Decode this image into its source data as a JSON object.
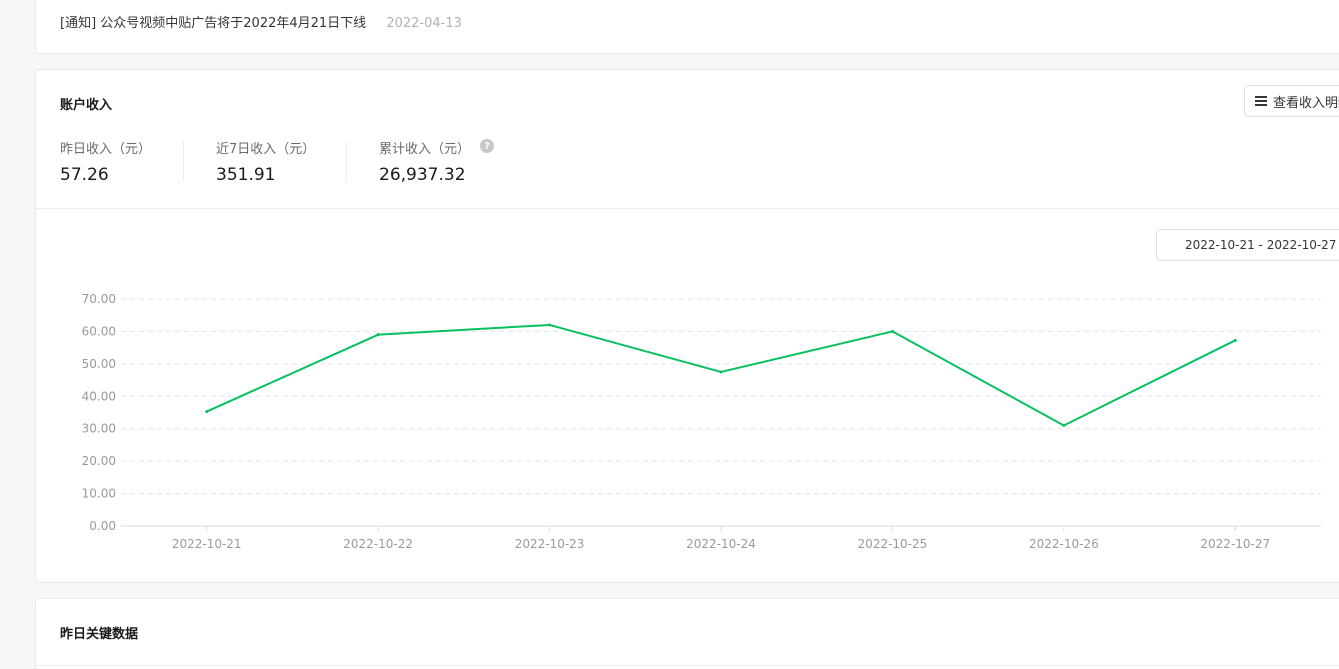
{
  "notice": {
    "text": "[通知] 公众号视频中贴广告将于2022年4月21日下线",
    "date": "2022-04-13"
  },
  "income": {
    "title": "账户收入",
    "detail_button": "查看收入明细",
    "stats": [
      {
        "label": "昨日收入（元）",
        "value": "57.26"
      },
      {
        "label": "近7日收入（元）",
        "value": "351.91"
      },
      {
        "label": "累计收入（元）",
        "value": "26,937.32"
      }
    ],
    "help_icon": "?",
    "date_range": "2022-10-21 - 2022-10-27"
  },
  "keydata": {
    "title": "昨日关键数据"
  },
  "colors": {
    "accent": "#07c160",
    "grid": "#e5e5e5",
    "axis_text": "#9a9a9a"
  },
  "chart_data": {
    "type": "line",
    "x": [
      "2022-10-21",
      "2022-10-22",
      "2022-10-23",
      "2022-10-24",
      "2022-10-25",
      "2022-10-26",
      "2022-10-27"
    ],
    "series": [
      {
        "values": [
          35.3,
          59.0,
          62.0,
          47.5,
          60.0,
          31.0,
          57.26
        ]
      }
    ],
    "yticks": [
      "0.00",
      "10.00",
      "20.00",
      "30.00",
      "40.00",
      "50.00",
      "60.00",
      "70.00"
    ],
    "ylim": [
      0,
      70
    ],
    "grid": true,
    "legend": "none"
  }
}
